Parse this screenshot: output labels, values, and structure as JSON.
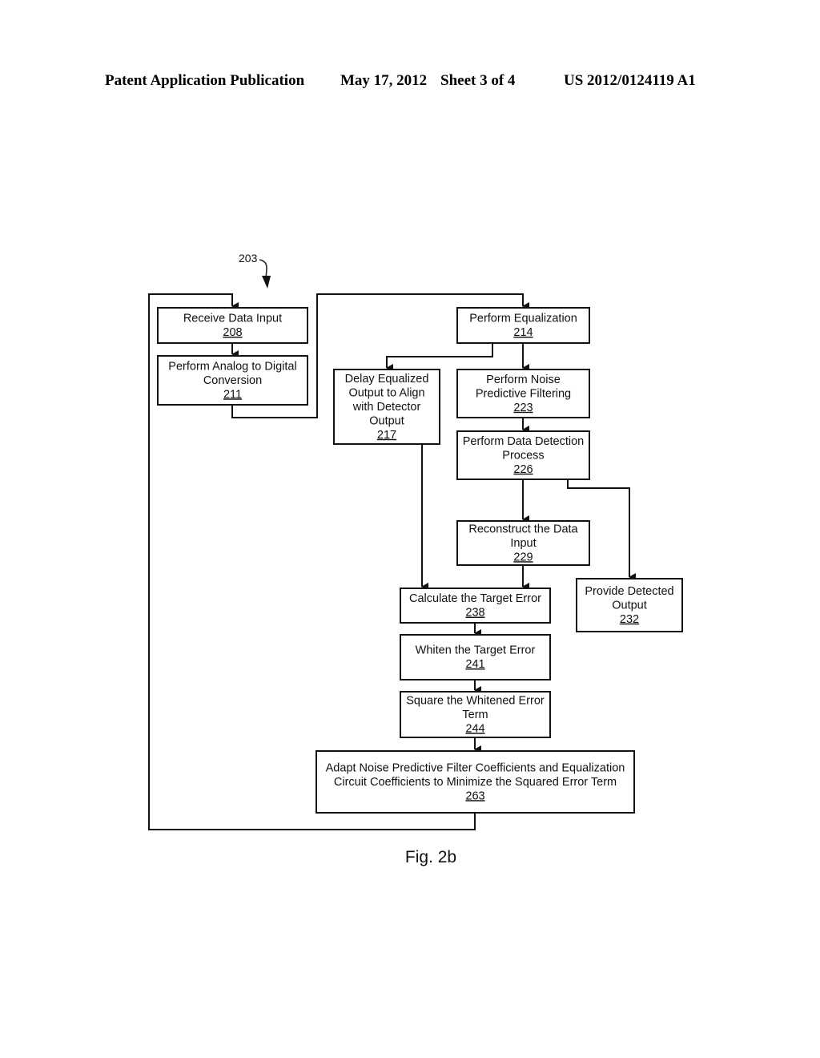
{
  "header": {
    "publication": "Patent Application Publication",
    "date": "May 17, 2012",
    "sheet": "Sheet 3 of 4",
    "patent_number": "US 2012/0124119 A1"
  },
  "figure": {
    "reference": "203",
    "caption": "Fig. 2b"
  },
  "boxes": [
    {
      "id": "208",
      "lines": [
        "Receive Data Input"
      ],
      "ref": "208"
    },
    {
      "id": "211",
      "lines": [
        "Perform Analog to Digital",
        "Conversion"
      ],
      "ref": "211"
    },
    {
      "id": "214",
      "lines": [
        "Perform Equalization"
      ],
      "ref": "214"
    },
    {
      "id": "217",
      "lines": [
        "Delay Equalized",
        "Output to Align",
        "with Detector",
        "Output"
      ],
      "ref": "217"
    },
    {
      "id": "223",
      "lines": [
        "Perform Noise",
        "Predictive Filtering"
      ],
      "ref": "223"
    },
    {
      "id": "226",
      "lines": [
        "Perform Data Detection",
        "Process"
      ],
      "ref": "226"
    },
    {
      "id": "229",
      "lines": [
        "Reconstruct the Data",
        "Input"
      ],
      "ref": "229"
    },
    {
      "id": "232",
      "lines": [
        "Provide Detected",
        "Output"
      ],
      "ref": "232"
    },
    {
      "id": "238",
      "lines": [
        "Calculate the Target Error"
      ],
      "ref": "238"
    },
    {
      "id": "241",
      "lines": [
        "Whiten the Target Error"
      ],
      "ref": "241"
    },
    {
      "id": "244",
      "lines": [
        "Square the Whitened Error",
        "Term"
      ],
      "ref": "244"
    },
    {
      "id": "263",
      "lines": [
        "Adapt Noise Predictive Filter Coefficients and Equalization",
        "Circuit Coefficients to Minimize the Squared Error Term"
      ],
      "ref": "263"
    }
  ],
  "connections": [
    {
      "from": "263",
      "to": "208",
      "type": "feedback-loop"
    },
    {
      "from": "208",
      "to": "211"
    },
    {
      "from": "211",
      "to": "214"
    },
    {
      "from": "214",
      "to": "217"
    },
    {
      "from": "214",
      "to": "223"
    },
    {
      "from": "223",
      "to": "226"
    },
    {
      "from": "226",
      "to": "229"
    },
    {
      "from": "226",
      "to": "232"
    },
    {
      "from": "217",
      "to": "238"
    },
    {
      "from": "229",
      "to": "238"
    },
    {
      "from": "238",
      "to": "241"
    },
    {
      "from": "241",
      "to": "244"
    },
    {
      "from": "244",
      "to": "263"
    }
  ]
}
